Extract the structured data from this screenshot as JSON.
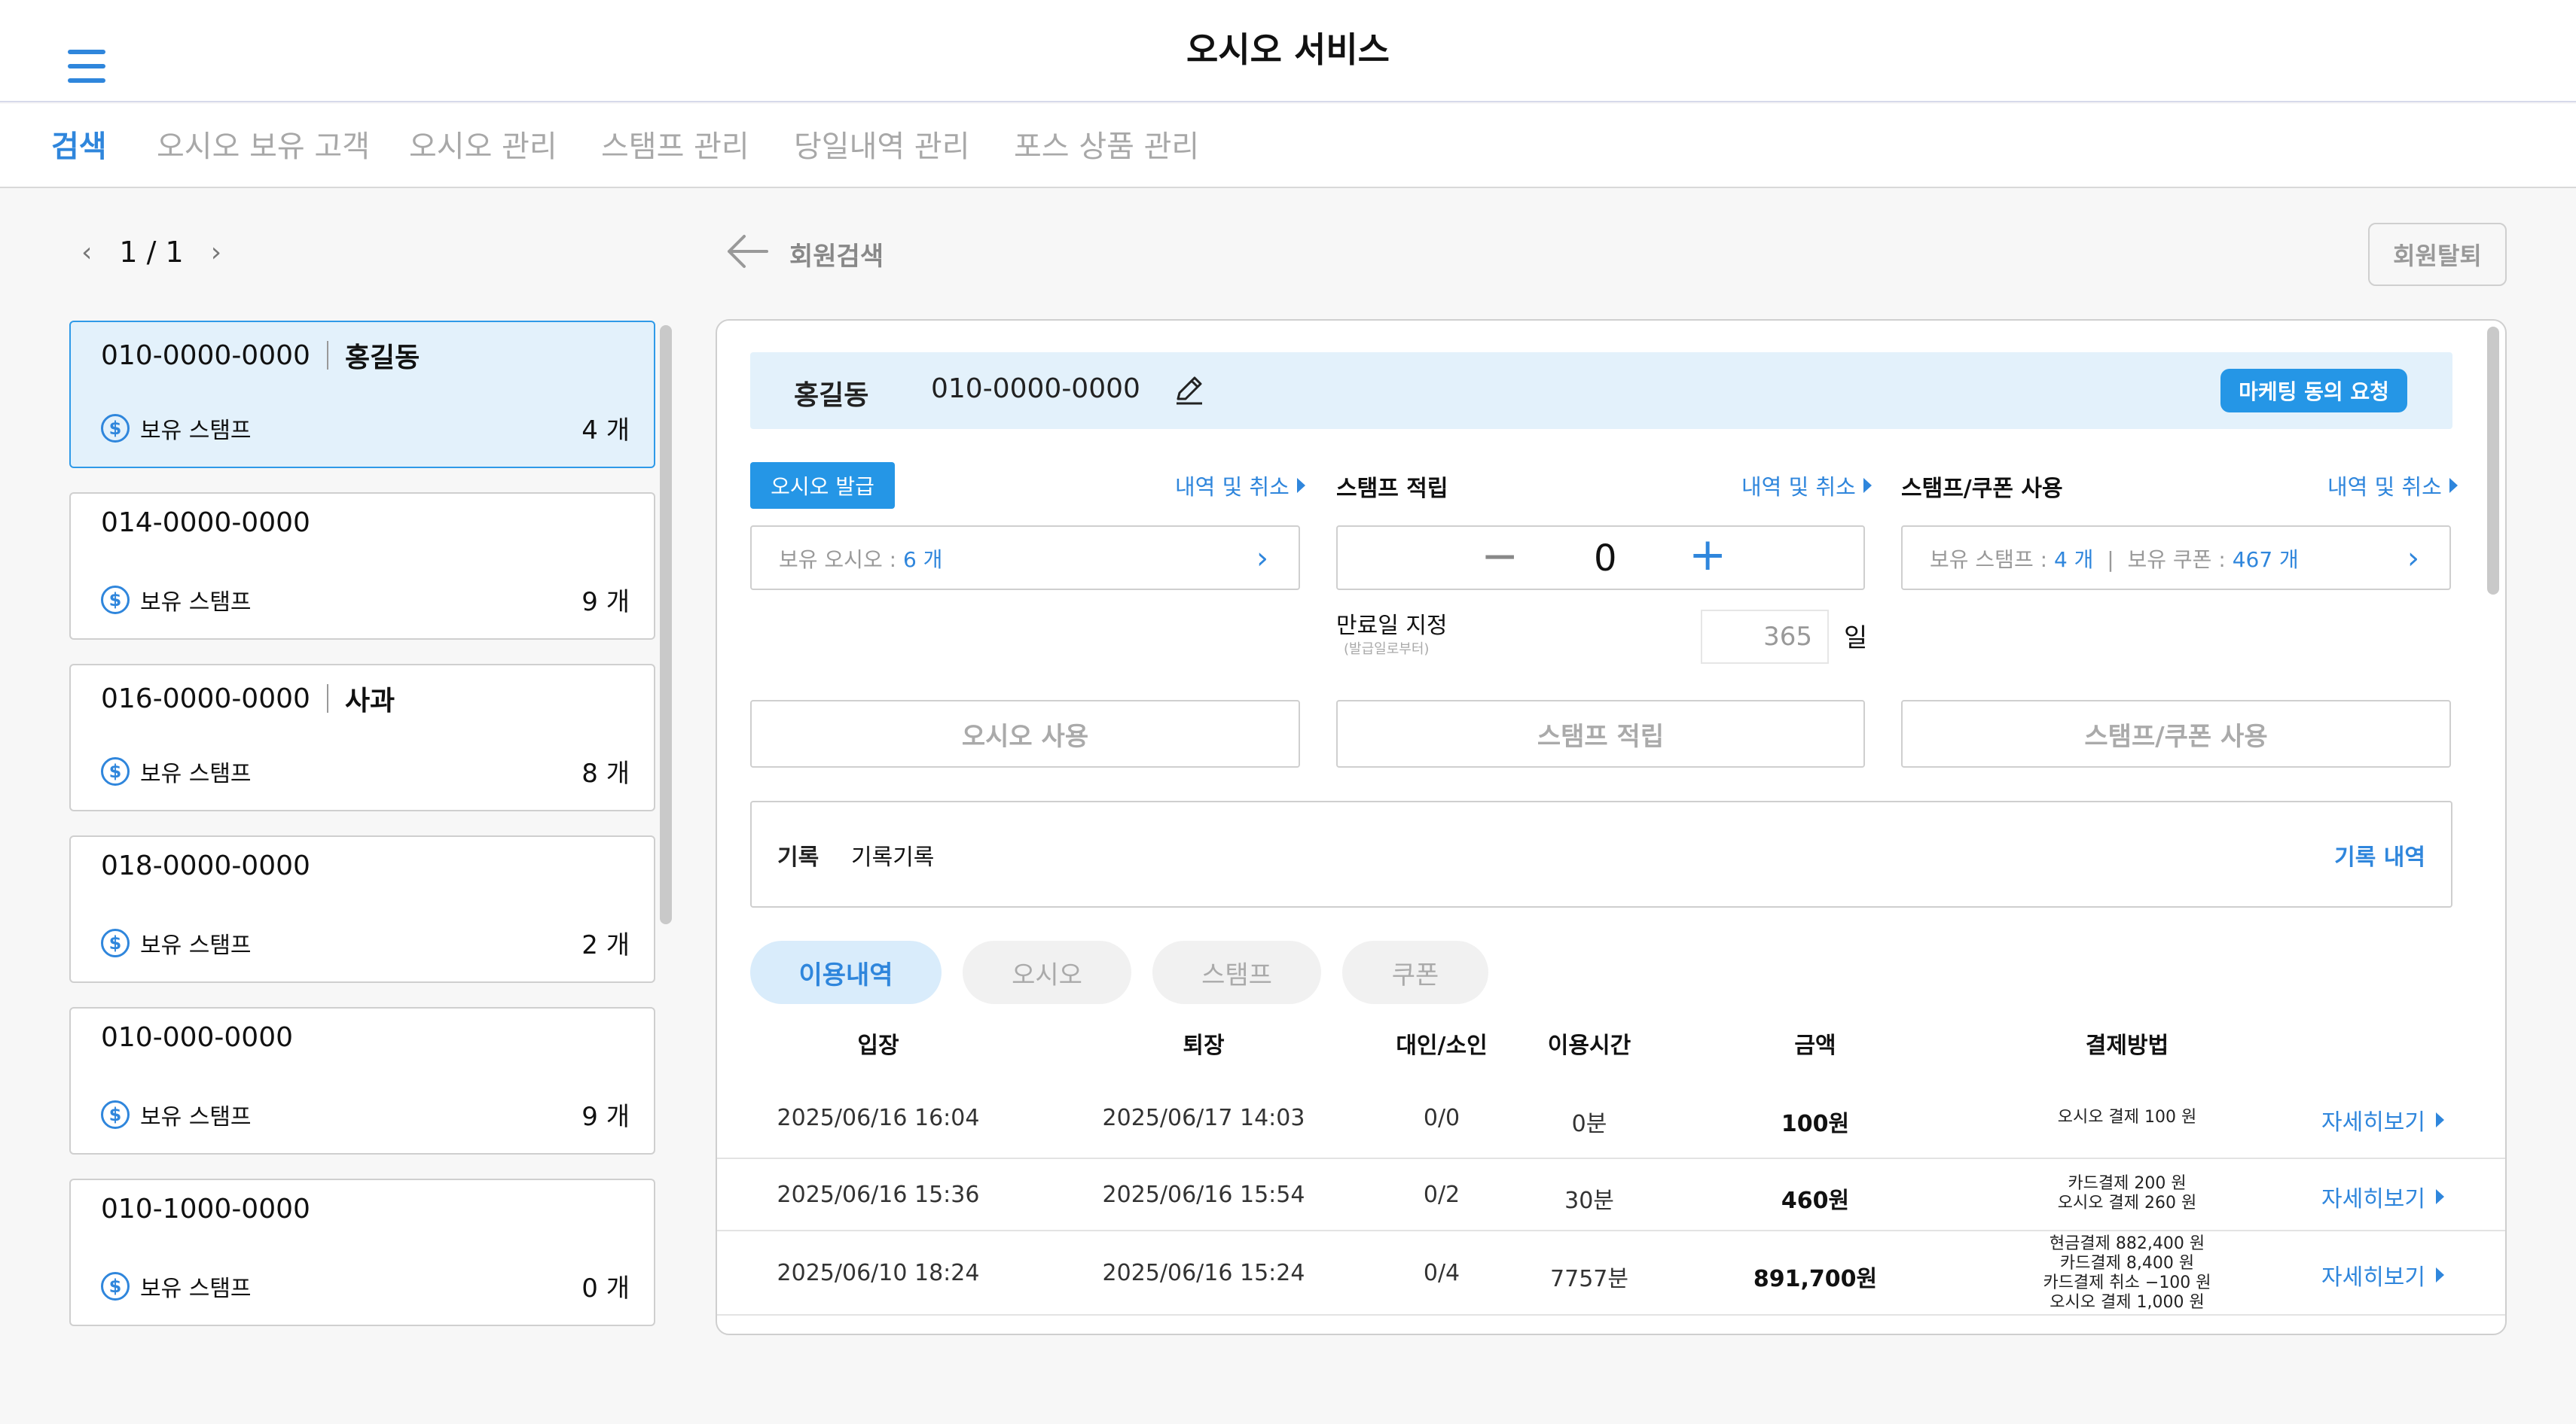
{
  "header": {
    "title": "오시오 서비스",
    "menu_icon": "hamburger-menu-icon"
  },
  "tabs": [
    {
      "label": "검색",
      "active": true
    },
    {
      "label": "오시오 보유 고객",
      "active": false
    },
    {
      "label": "오시오 관리",
      "active": false
    },
    {
      "label": "스탬프 관리",
      "active": false
    },
    {
      "label": "당일내역 관리",
      "active": false
    },
    {
      "label": "포스 상품 관리",
      "active": false
    }
  ],
  "pager": {
    "prev": "‹",
    "text": "1 / 1",
    "next": "›"
  },
  "members": [
    {
      "phone": "010-0000-0000",
      "name": "홍길동",
      "stamp_label": "보유 스탬프",
      "count": "4 개",
      "selected": true
    },
    {
      "phone": "014-0000-0000",
      "name": "",
      "stamp_label": "보유 스탬프",
      "count": "9 개",
      "selected": false
    },
    {
      "phone": "016-0000-0000",
      "name": "사과",
      "stamp_label": "보유 스탬프",
      "count": "8 개",
      "selected": false
    },
    {
      "phone": "018-0000-0000",
      "name": "",
      "stamp_label": "보유 스탬프",
      "count": "2 개",
      "selected": false
    },
    {
      "phone": "010-000-0000",
      "name": "",
      "stamp_label": "보유 스탬프",
      "count": "9 개",
      "selected": false
    },
    {
      "phone": "010-1000-0000",
      "name": "",
      "stamp_label": "보유 스탬프",
      "count": "0 개",
      "selected": false
    }
  ],
  "back": {
    "label": "회원검색"
  },
  "withdraw_button": "회원탈퇴",
  "customer": {
    "name": "홍길동",
    "phone": "010-0000-0000",
    "marketing_button": "마케팅 동의 요청"
  },
  "oshio": {
    "issue_button": "오시오 발급",
    "history_link": "내역 및 취소",
    "holding_label": "보유 오시오 :",
    "holding_value": "6 개",
    "use_button": "오시오 사용"
  },
  "stamp_accrual": {
    "title": "스탬프 적립",
    "history_link": "내역 및 취소",
    "minus": "−",
    "value": "0",
    "plus": "+",
    "expiry_label": "만료일 지정",
    "expiry_sub": "(발급일로부터)",
    "expiry_value": "365",
    "expiry_unit": "일",
    "button": "스탬프 적립"
  },
  "stamp_use": {
    "title": "스탬프/쿠폰 사용",
    "history_link": "내역 및 취소",
    "stamp_label": "보유 스탬프 :",
    "stamp_value": "4 개",
    "separator": "|",
    "coupon_label": "보유 쿠폰 :",
    "coupon_value": "467 개",
    "button": "스탬프/쿠폰 사용"
  },
  "record": {
    "label": "기록",
    "text": "기록기록",
    "link": "기록 내역"
  },
  "history_tabs": [
    {
      "label": "이용내역",
      "active": true
    },
    {
      "label": "오시오",
      "active": false
    },
    {
      "label": "스탬프",
      "active": false
    },
    {
      "label": "쿠폰",
      "active": false
    }
  ],
  "table": {
    "headers": [
      "입장",
      "퇴장",
      "대인/소인",
      "이용시간",
      "금액",
      "결제방법"
    ],
    "rows": [
      {
        "in": "2025/06/16 16:04",
        "out": "2025/06/17 14:03",
        "people": "0/0",
        "time": "0분",
        "amount": "100원",
        "payment": [
          "오시오 결제 100 원"
        ],
        "link": "자세히보기"
      },
      {
        "in": "2025/06/16 15:36",
        "out": "2025/06/16 15:54",
        "people": "0/2",
        "time": "30분",
        "amount": "460원",
        "payment": [
          "카드결제 200 원",
          "오시오 결제 260 원"
        ],
        "link": "자세히보기"
      },
      {
        "in": "2025/06/10 18:24",
        "out": "2025/06/16 15:24",
        "people": "0/4",
        "time": "7757분",
        "amount": "891,700원",
        "payment": [
          "현금결제 882,400 원",
          "카드결제 8,400 원",
          "카드결제 취소 −100 원",
          "오시오 결제 1,000 원"
        ],
        "link": "자세히보기"
      }
    ]
  },
  "colors": {
    "accent": "#2f86dc",
    "button": "#2596e6",
    "selected_bg": "#e3f1fb"
  }
}
